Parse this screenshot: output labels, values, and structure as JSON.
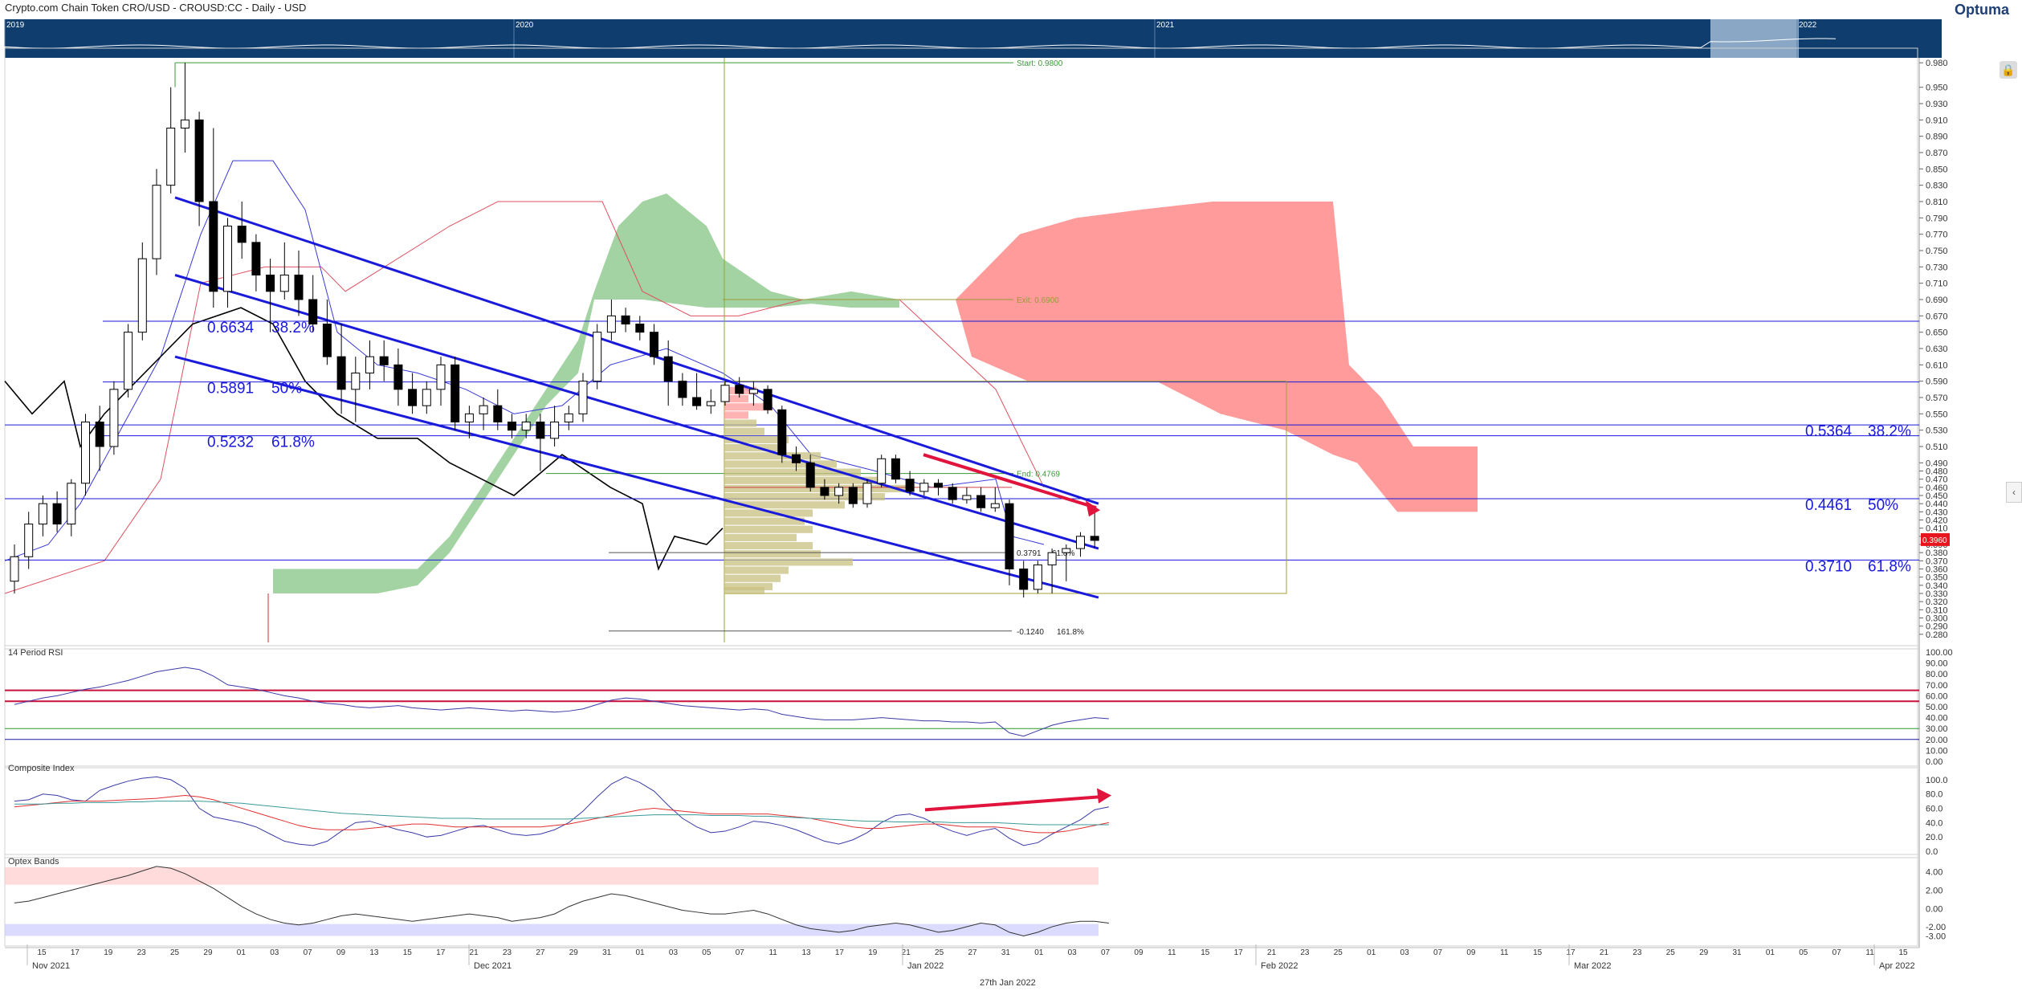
{
  "header": {
    "title": "Crypto.com Chain Token CRO/USD - CROUSD:CC - Daily - USD",
    "brand": "Optuma"
  },
  "navigator": {
    "years": [
      "2019",
      "2020",
      "2021",
      "2022"
    ]
  },
  "footer": {
    "date": "27th Jan 2022"
  },
  "colors": {
    "bull": "#ffffff",
    "bear": "#000000",
    "fib": "#1a1adb",
    "cloud_bull": "#8cc88c",
    "cloud_bear": "#ff8a8a",
    "annotation": "#e0143c"
  },
  "icons": {
    "lock": "lock-icon",
    "collapse": "chevron-left-icon",
    "brand": "optuma-logo-icon"
  },
  "chart_data": [
    {
      "type": "candlestick",
      "title": "",
      "ylim": [
        0.27,
        0.99
      ],
      "y_ticks": [
        "0.980",
        "0.950",
        "0.930",
        "0.910",
        "0.890",
        "0.870",
        "0.850",
        "0.830",
        "0.810",
        "0.790",
        "0.770",
        "0.750",
        "0.730",
        "0.710",
        "0.690",
        "0.670",
        "0.650",
        "0.630",
        "0.610",
        "0.590",
        "0.570",
        "0.550",
        "0.530",
        "0.510",
        "0.490",
        "0.480",
        "0.470",
        "0.460",
        "0.450",
        "0.440",
        "0.430",
        "0.420",
        "0.410",
        "0.400",
        "0.390",
        "0.380",
        "0.370",
        "0.360",
        "0.350",
        "0.340",
        "0.330",
        "0.320",
        "0.310",
        "0.300",
        "0.290",
        "0.280"
      ],
      "x_ticks": [
        "15",
        "17",
        "19",
        "23",
        "25",
        "29",
        "01",
        "03",
        "07",
        "09",
        "13",
        "15",
        "17",
        "21",
        "23",
        "27",
        "29",
        "31",
        "01",
        "03",
        "05",
        "07",
        "11",
        "13",
        "17",
        "19",
        "21",
        "25",
        "27",
        "31",
        "01",
        "03",
        "07",
        "09",
        "11",
        "15",
        "17",
        "21",
        "23",
        "25",
        "01",
        "03",
        "07",
        "09",
        "11",
        "15",
        "17",
        "21",
        "23",
        "25",
        "29",
        "31",
        "01",
        "05",
        "07",
        "11",
        "15"
      ],
      "months": [
        "Nov 2021",
        "Dec 2021",
        "Jan 2022",
        "Feb 2022",
        "Mar 2022",
        "Apr 2022"
      ],
      "candles": [
        [
          0.345,
          0.39,
          0.33,
          0.375
        ],
        [
          0.375,
          0.43,
          0.36,
          0.415
        ],
        [
          0.415,
          0.45,
          0.4,
          0.44
        ],
        [
          0.44,
          0.455,
          0.405,
          0.415
        ],
        [
          0.415,
          0.47,
          0.4,
          0.465
        ],
        [
          0.465,
          0.55,
          0.45,
          0.54
        ],
        [
          0.54,
          0.56,
          0.48,
          0.51
        ],
        [
          0.51,
          0.59,
          0.5,
          0.58
        ],
        [
          0.58,
          0.66,
          0.57,
          0.65
        ],
        [
          0.65,
          0.76,
          0.64,
          0.74
        ],
        [
          0.74,
          0.85,
          0.72,
          0.83
        ],
        [
          0.83,
          0.95,
          0.82,
          0.9
        ],
        [
          0.9,
          0.98,
          0.87,
          0.91
        ],
        [
          0.91,
          0.92,
          0.78,
          0.81
        ],
        [
          0.81,
          0.9,
          0.68,
          0.7
        ],
        [
          0.7,
          0.79,
          0.68,
          0.78
        ],
        [
          0.78,
          0.81,
          0.74,
          0.76
        ],
        [
          0.76,
          0.77,
          0.7,
          0.72
        ],
        [
          0.72,
          0.74,
          0.65,
          0.7
        ],
        [
          0.7,
          0.76,
          0.69,
          0.72
        ],
        [
          0.72,
          0.75,
          0.67,
          0.69
        ],
        [
          0.69,
          0.72,
          0.65,
          0.66
        ],
        [
          0.66,
          0.69,
          0.61,
          0.62
        ],
        [
          0.62,
          0.66,
          0.55,
          0.58
        ],
        [
          0.58,
          0.62,
          0.54,
          0.6
        ],
        [
          0.6,
          0.64,
          0.58,
          0.62
        ],
        [
          0.62,
          0.64,
          0.59,
          0.61
        ],
        [
          0.61,
          0.63,
          0.56,
          0.58
        ],
        [
          0.58,
          0.6,
          0.55,
          0.56
        ],
        [
          0.56,
          0.59,
          0.55,
          0.58
        ],
        [
          0.58,
          0.62,
          0.56,
          0.61
        ],
        [
          0.61,
          0.62,
          0.53,
          0.54
        ],
        [
          0.54,
          0.56,
          0.52,
          0.55
        ],
        [
          0.55,
          0.57,
          0.53,
          0.56
        ],
        [
          0.56,
          0.58,
          0.53,
          0.54
        ],
        [
          0.54,
          0.55,
          0.52,
          0.53
        ],
        [
          0.53,
          0.55,
          0.52,
          0.54
        ],
        [
          0.54,
          0.55,
          0.48,
          0.52
        ],
        [
          0.52,
          0.56,
          0.51,
          0.54
        ],
        [
          0.54,
          0.56,
          0.53,
          0.55
        ],
        [
          0.55,
          0.6,
          0.54,
          0.59
        ],
        [
          0.59,
          0.66,
          0.58,
          0.65
        ],
        [
          0.65,
          0.69,
          0.64,
          0.67
        ],
        [
          0.67,
          0.68,
          0.65,
          0.66
        ],
        [
          0.66,
          0.67,
          0.64,
          0.65
        ],
        [
          0.65,
          0.66,
          0.61,
          0.62
        ],
        [
          0.62,
          0.64,
          0.56,
          0.59
        ],
        [
          0.59,
          0.6,
          0.56,
          0.57
        ],
        [
          0.57,
          0.6,
          0.555,
          0.56
        ],
        [
          0.56,
          0.58,
          0.55,
          0.565
        ],
        [
          0.565,
          0.59,
          0.56,
          0.585
        ],
        [
          0.585,
          0.595,
          0.57,
          0.575
        ],
        [
          0.575,
          0.59,
          0.56,
          0.58
        ],
        [
          0.58,
          0.585,
          0.55,
          0.555
        ],
        [
          0.555,
          0.56,
          0.49,
          0.5
        ],
        [
          0.5,
          0.51,
          0.48,
          0.49
        ],
        [
          0.49,
          0.5,
          0.455,
          0.46
        ],
        [
          0.46,
          0.47,
          0.445,
          0.45
        ],
        [
          0.45,
          0.465,
          0.44,
          0.46
        ],
        [
          0.46,
          0.465,
          0.435,
          0.44
        ],
        [
          0.44,
          0.47,
          0.435,
          0.465
        ],
        [
          0.465,
          0.5,
          0.46,
          0.495
        ],
        [
          0.495,
          0.5,
          0.465,
          0.47
        ],
        [
          0.47,
          0.48,
          0.45,
          0.455
        ],
        [
          0.455,
          0.47,
          0.45,
          0.465
        ],
        [
          0.465,
          0.47,
          0.45,
          0.46
        ],
        [
          0.46,
          0.465,
          0.44,
          0.445
        ],
        [
          0.445,
          0.46,
          0.44,
          0.45
        ],
        [
          0.45,
          0.46,
          0.43,
          0.435
        ],
        [
          0.435,
          0.46,
          0.43,
          0.44
        ],
        [
          0.44,
          0.445,
          0.34,
          0.36
        ],
        [
          0.36,
          0.37,
          0.325,
          0.335
        ],
        [
          0.335,
          0.37,
          0.33,
          0.365
        ],
        [
          0.365,
          0.385,
          0.33,
          0.38
        ],
        [
          0.38,
          0.39,
          0.345,
          0.385
        ],
        [
          0.385,
          0.405,
          0.375,
          0.4
        ],
        [
          0.4,
          0.43,
          0.385,
          0.395
        ]
      ],
      "fib_levels": [
        {
          "label": "0.6634",
          "pct": "38.2%",
          "value": 0.6634
        },
        {
          "label": "0.5891",
          "pct": "50%",
          "value": 0.5891
        },
        {
          "label": "0.5232",
          "pct": "61.8%",
          "value": 0.5232
        },
        {
          "label": "0.5364",
          "pct": "38.2%",
          "value": 0.5364
        },
        {
          "label": "0.4461",
          "pct": "50%",
          "value": 0.4461
        },
        {
          "label": "0.3710",
          "pct": "61.8%",
          "value": 0.371
        }
      ],
      "annotations": {
        "start": "Start: 0.9800",
        "exit": "Exit: 0.6900",
        "end": "End: 0.4769",
        "ext1_value": "0.3791",
        "ext1_pct": "61.8%",
        "ext2_value": "-0.1240",
        "ext2_pct": "161.8%",
        "price_tag": "0.3960"
      }
    },
    {
      "type": "line",
      "title": "14 Period RSI",
      "ylim": [
        0,
        100
      ],
      "y_ticks": [
        "100.00",
        "90.00",
        "80.00",
        "70.00",
        "60.00",
        "50.00",
        "40.00",
        "30.00",
        "20.00",
        "10.00",
        "0.00"
      ],
      "overbought": 65,
      "overbought2": 55,
      "oversold": 30,
      "oversold2": 20,
      "values": [
        52,
        55,
        58,
        60,
        63,
        66,
        68,
        71,
        74,
        78,
        82,
        84,
        86,
        84,
        78,
        70,
        68,
        66,
        63,
        60,
        58,
        55,
        53,
        52,
        50,
        49,
        50,
        51,
        49,
        48,
        47,
        48,
        49,
        48,
        47,
        46,
        47,
        46,
        45,
        46,
        48,
        52,
        56,
        58,
        57,
        55,
        53,
        51,
        50,
        49,
        48,
        47,
        48,
        47,
        43,
        41,
        39,
        38,
        38,
        38,
        39,
        40,
        39,
        38,
        37,
        37,
        36,
        36,
        35,
        36,
        26,
        23,
        28,
        33,
        36,
        38,
        40,
        39
      ]
    },
    {
      "type": "line",
      "title": "Composite Index",
      "ylim": [
        0,
        110
      ],
      "y_ticks": [
        "100.0",
        "80.0",
        "60.0",
        "40.0",
        "20.0",
        "0.0"
      ],
      "series": [
        {
          "values": [
            70,
            72,
            80,
            78,
            72,
            70,
            85,
            92,
            98,
            102,
            104,
            100,
            88,
            60,
            48,
            44,
            40,
            34,
            24,
            14,
            10,
            8,
            14,
            28,
            40,
            42,
            36,
            30,
            26,
            20,
            22,
            28,
            34,
            36,
            30,
            24,
            22,
            24,
            30,
            40,
            56,
            76,
            94,
            104,
            96,
            84,
            64,
            46,
            34,
            26,
            28,
            34,
            42,
            40,
            36,
            30,
            22,
            14,
            10,
            16,
            26,
            40,
            50,
            52,
            46,
            36,
            28,
            22,
            28,
            32,
            18,
            8,
            12,
            24,
            34,
            44,
            58,
            62
          ]
        },
        {
          "values": [
            62,
            64,
            66,
            68,
            70,
            70,
            70,
            71,
            72,
            73,
            74,
            76,
            78,
            76,
            72,
            66,
            60,
            54,
            48,
            42,
            36,
            32,
            30,
            30,
            30,
            32,
            34,
            36,
            38,
            38,
            36,
            34,
            34,
            34,
            34,
            34,
            34,
            34,
            36,
            38,
            42,
            46,
            50,
            54,
            58,
            60,
            58,
            56,
            54,
            52,
            52,
            52,
            52,
            52,
            50,
            48,
            46,
            42,
            38,
            34,
            32,
            32,
            34,
            36,
            38,
            38,
            36,
            34,
            34,
            34,
            32,
            28,
            26,
            26,
            28,
            32,
            36,
            40
          ]
        },
        {
          "values": [
            66,
            66,
            66,
            67,
            67,
            68,
            68,
            68,
            69,
            69,
            70,
            70,
            70,
            70,
            69,
            68,
            67,
            65,
            63,
            61,
            59,
            57,
            55,
            53,
            52,
            51,
            50,
            49,
            48,
            47,
            46,
            46,
            46,
            45,
            45,
            45,
            45,
            45,
            45,
            45,
            46,
            47,
            48,
            49,
            50,
            51,
            51,
            51,
            51,
            50,
            50,
            50,
            49,
            49,
            48,
            47,
            46,
            45,
            44,
            43,
            42,
            42,
            41,
            41,
            41,
            41,
            40,
            40,
            40,
            40,
            39,
            38,
            37,
            37,
            37,
            37,
            37,
            37
          ]
        }
      ]
    },
    {
      "type": "line",
      "title": "Optex Bands",
      "ylim": [
        -3.4,
        5.2
      ],
      "y_ticks": [
        "4.00",
        "2.00",
        "0.00",
        "-2.00",
        "-3.00"
      ],
      "upper_band": [
        4.5,
        2.6
      ],
      "lower_band": [
        -1.7,
        -3.0
      ],
      "values": [
        0.6,
        0.8,
        1.2,
        1.6,
        2.0,
        2.4,
        2.8,
        3.2,
        3.6,
        4.1,
        4.6,
        4.4,
        3.8,
        3.0,
        2.2,
        1.2,
        0.2,
        -0.6,
        -1.2,
        -1.6,
        -1.8,
        -1.6,
        -1.2,
        -0.8,
        -0.6,
        -0.8,
        -1.0,
        -1.2,
        -1.4,
        -1.2,
        -1.0,
        -0.8,
        -0.6,
        -0.8,
        -1.0,
        -1.4,
        -1.2,
        -1.0,
        -0.6,
        0.2,
        0.8,
        1.2,
        1.6,
        1.4,
        1.0,
        0.6,
        0.2,
        -0.2,
        -0.4,
        -0.6,
        -0.6,
        -0.4,
        -0.2,
        -0.6,
        -1.2,
        -1.8,
        -2.2,
        -2.4,
        -2.6,
        -2.4,
        -2.0,
        -1.8,
        -1.6,
        -1.8,
        -2.2,
        -2.6,
        -2.4,
        -2.0,
        -1.6,
        -1.8,
        -2.6,
        -3.0,
        -2.6,
        -2.0,
        -1.6,
        -1.4,
        -1.4,
        -1.6
      ]
    }
  ]
}
